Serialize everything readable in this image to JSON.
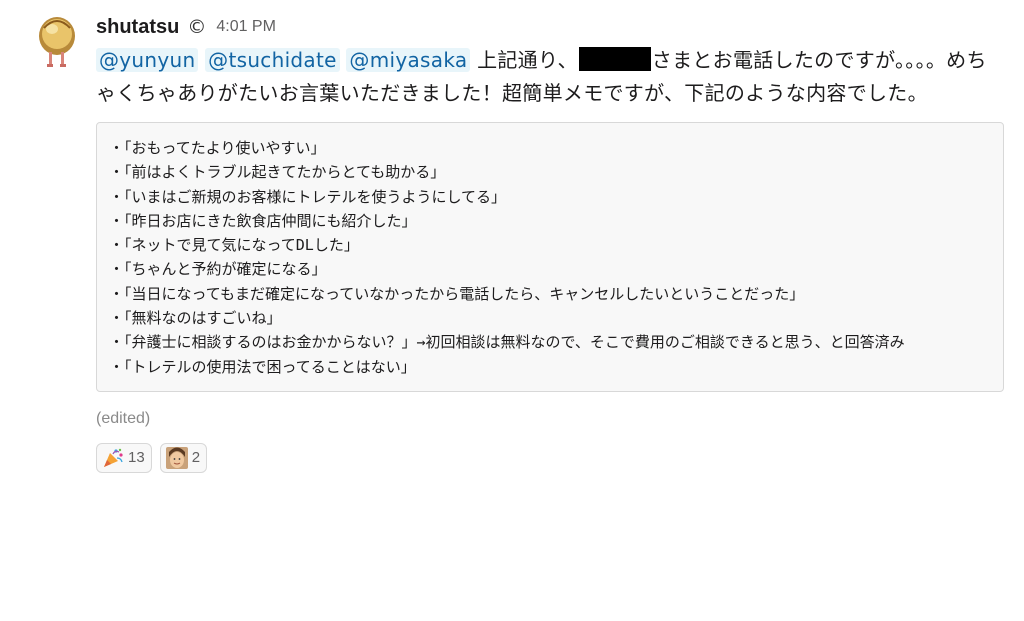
{
  "message": {
    "username": "shutatsu",
    "status_icon": "©",
    "timestamp": "4:01 PM",
    "mentions": [
      "@yunyun",
      "@tsuchidate",
      "@miyasaka"
    ],
    "text_before_redaction": "上記通り、",
    "text_after_redaction": "さまとお電話したのですが。。。。めちゃくちゃありがたいお言葉いただきました！超簡単メモですが、下記のような内容でした。",
    "code_lines": [
      "・「おもってたより使いやすい」",
      "・「前はよくトラブル起きてたからとても助かる」",
      "・「いまはご新規のお客様にトレテルを使うようにしてる」",
      "・「昨日お店にきた飲食店仲間にも紹介した」",
      "・「ネットで見て気になってDLした」",
      "・「ちゃんと予約が確定になる」",
      "・「当日になってもまだ確定になっていなかったから電話したら、キャンセルしたいということだった」",
      "・「無料なのはすごいね」",
      "・「弁護士に相談するのはお金かからない？」→初回相談は無料なので、そこで費用のご相談できると思う、と回答済み",
      "・「トレテルの使用法で困ってることはない」"
    ],
    "edited_label": "(edited)",
    "reactions": [
      {
        "icon": "party-popper-icon",
        "count": "13"
      },
      {
        "icon": "person-face-icon",
        "count": "2"
      }
    ]
  }
}
